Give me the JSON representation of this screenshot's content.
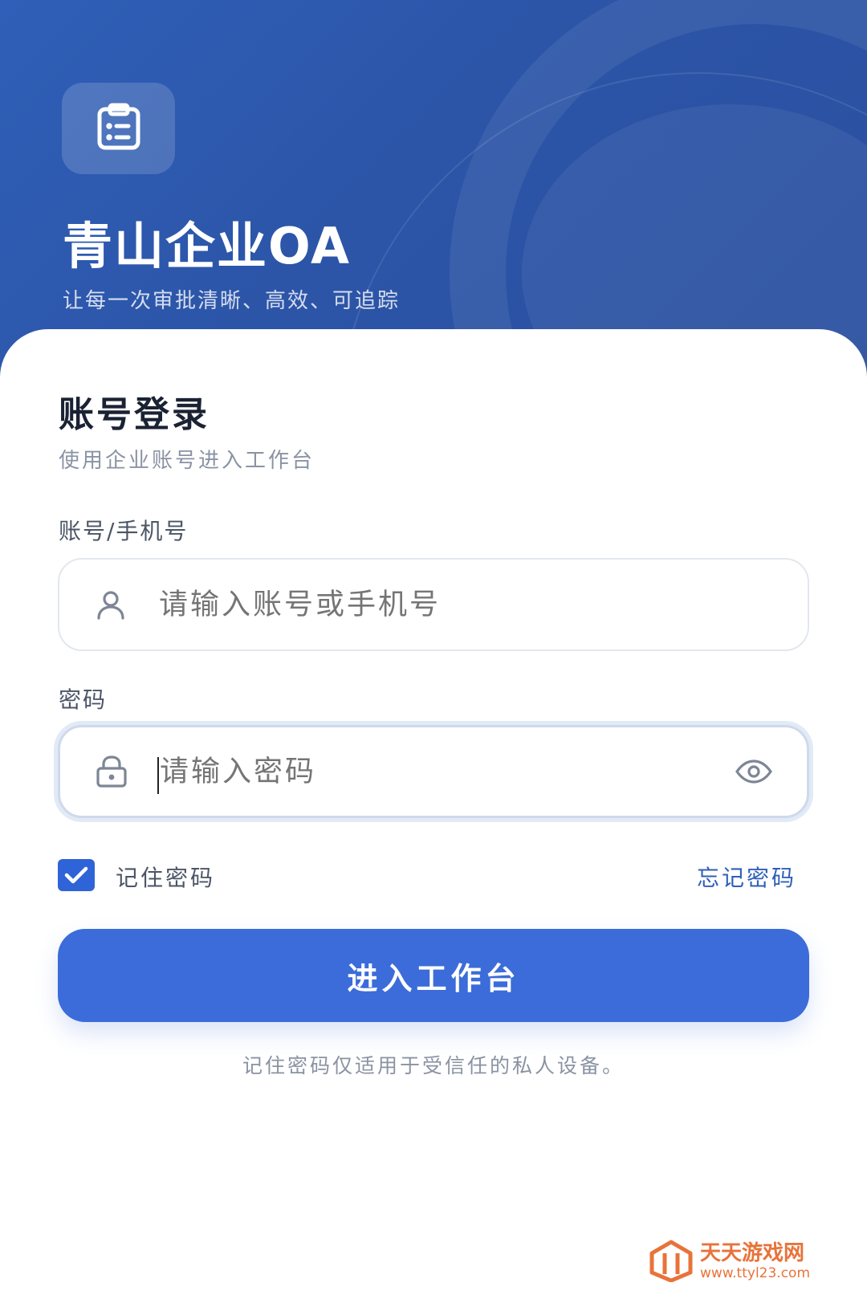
{
  "header": {
    "app_name": "青山企业OA",
    "tagline": "让每一次审批清晰、高效、可追踪",
    "logo_icon": "clipboard-icon"
  },
  "login": {
    "title": "账号登录",
    "subtitle": "使用企业账号进入工作台",
    "account": {
      "label": "账号/手机号",
      "placeholder": "请输入账号或手机号",
      "icon": "user-icon"
    },
    "password": {
      "label": "密码",
      "placeholder": "请输入密码",
      "icon": "lock-icon",
      "toggle_icon": "eye-icon",
      "focused": true
    },
    "remember": {
      "label": "记住密码",
      "checked": true
    },
    "forgot_label": "忘记密码",
    "submit_label": "进入工作台",
    "hint": "记住密码仅适用于受信任的私人设备。"
  },
  "watermark": {
    "title": "天天游戏网",
    "url": "www.ttyl23.com"
  },
  "colors": {
    "header_bg": "#2c55a8",
    "primary": "#3b6cd9",
    "link": "#2f5fb8",
    "watermark": "#e8733a"
  }
}
